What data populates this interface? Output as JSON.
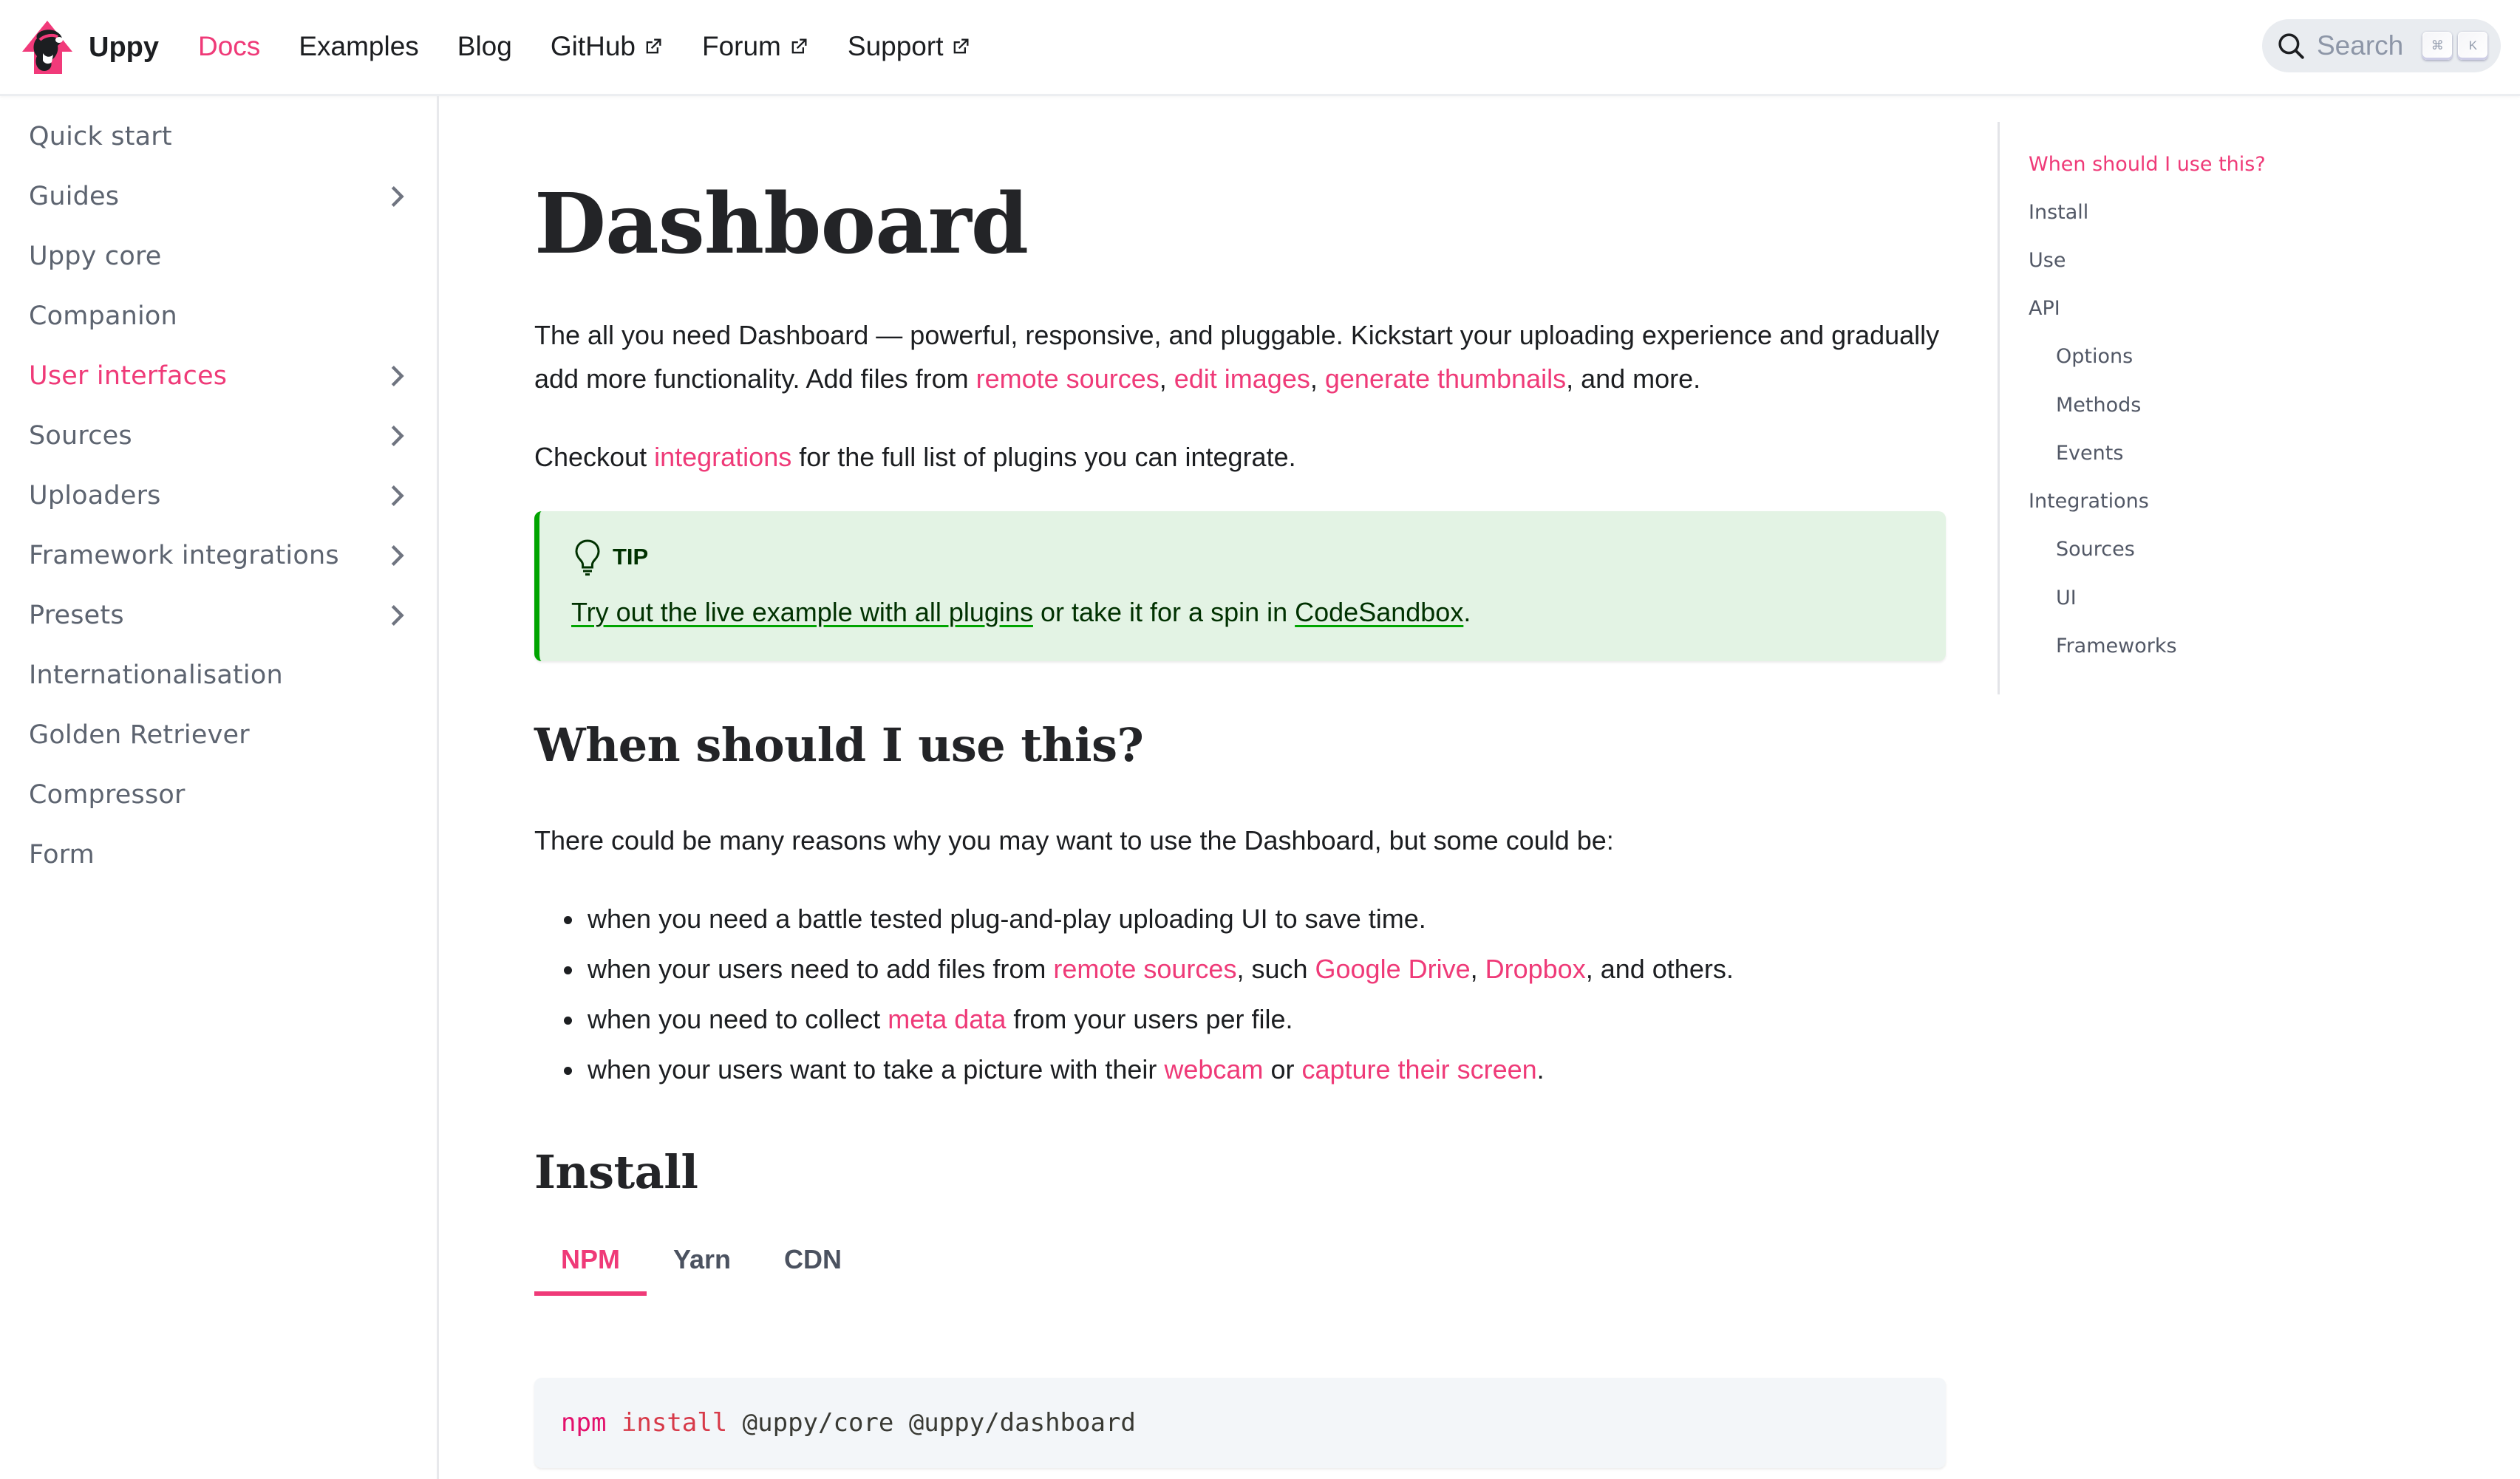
{
  "navbar": {
    "brand": "Uppy",
    "links": [
      {
        "label": "Docs",
        "active": true,
        "external": false
      },
      {
        "label": "Examples",
        "active": false,
        "external": false
      },
      {
        "label": "Blog",
        "active": false,
        "external": false
      },
      {
        "label": "GitHub",
        "active": false,
        "external": true
      },
      {
        "label": "Forum",
        "active": false,
        "external": true
      },
      {
        "label": "Support",
        "active": false,
        "external": true
      }
    ],
    "search": {
      "placeholder": "Search",
      "shortcut_keys": [
        "⌘",
        "K"
      ]
    }
  },
  "sidebar": {
    "items": [
      {
        "label": "Quick start",
        "expandable": false,
        "active": false
      },
      {
        "label": "Guides",
        "expandable": true,
        "active": false
      },
      {
        "label": "Uppy core",
        "expandable": false,
        "active": false
      },
      {
        "label": "Companion",
        "expandable": false,
        "active": false
      },
      {
        "label": "User interfaces",
        "expandable": true,
        "active": true
      },
      {
        "label": "Sources",
        "expandable": true,
        "active": false
      },
      {
        "label": "Uploaders",
        "expandable": true,
        "active": false
      },
      {
        "label": "Framework integrations",
        "expandable": true,
        "active": false
      },
      {
        "label": "Presets",
        "expandable": true,
        "active": false
      },
      {
        "label": "Internationalisation",
        "expandable": false,
        "active": false
      },
      {
        "label": "Golden Retriever",
        "expandable": false,
        "active": false
      },
      {
        "label": "Compressor",
        "expandable": false,
        "active": false
      },
      {
        "label": "Form",
        "expandable": false,
        "active": false
      }
    ]
  },
  "main": {
    "title": "Dashboard",
    "intro": {
      "t1": "The all you need Dashboard — powerful, responsive, and pluggable. Kickstart your uploading experience and gradually add more functionality. Add files from ",
      "link1": "remote sources",
      "t2": ", ",
      "link2": "edit images",
      "t3": ", ",
      "link3": "generate thumbnails",
      "t4": ", and more."
    },
    "checkout": {
      "t1": "Checkout ",
      "link": "integrations",
      "t2": " for the full list of plugins you can integrate."
    },
    "tip": {
      "label": "TIP",
      "link1": "Try out the live example with all plugins",
      "t1": " or take it for a spin in ",
      "link2": "CodeSandbox",
      "t2": "."
    },
    "when_heading": "When should I use this?",
    "when_intro": "There could be many reasons why you may want to use the Dashboard, but some could be:",
    "bullets": {
      "b1": {
        "t1": "when you need a battle tested plug-and-play uploading UI to save time."
      },
      "b2": {
        "t1": "when your users need to add files from ",
        "link1": "remote sources",
        "t2": ", such ",
        "link2": "Google Drive",
        "t3": ", ",
        "link3": "Dropbox",
        "t4": ", and others."
      },
      "b3": {
        "t1": "when you need to collect ",
        "link1": "meta data",
        "t2": " from your users per file."
      },
      "b4": {
        "t1": "when your users want to take a picture with their ",
        "link1": "webcam",
        "t2": " or ",
        "link2": "capture their screen",
        "t3": "."
      }
    },
    "install_heading": "Install",
    "install_tabs": [
      {
        "label": "NPM",
        "active": true
      },
      {
        "label": "Yarn",
        "active": false
      },
      {
        "label": "CDN",
        "active": false
      }
    ],
    "code": {
      "cmd": "npm",
      "sub": "install",
      "args": " @uppy/core @uppy/dashboard"
    }
  },
  "toc": {
    "items": [
      {
        "label": "When should I use this?",
        "level": 1,
        "active": true
      },
      {
        "label": "Install",
        "level": 1,
        "active": false
      },
      {
        "label": "Use",
        "level": 1,
        "active": false
      },
      {
        "label": "API",
        "level": 1,
        "active": false
      },
      {
        "label": "Options",
        "level": 2,
        "active": false
      },
      {
        "label": "Methods",
        "level": 2,
        "active": false
      },
      {
        "label": "Events",
        "level": 2,
        "active": false
      },
      {
        "label": "Integrations",
        "level": 1,
        "active": false
      },
      {
        "label": "Sources",
        "level": 2,
        "active": false
      },
      {
        "label": "UI",
        "level": 2,
        "active": false
      },
      {
        "label": "Frameworks",
        "level": 2,
        "active": false
      }
    ]
  },
  "colors": {
    "accent": "#ef3a78",
    "tip_background": "#e3f3e4",
    "tip_border": "#00a400",
    "code_background": "#f3f6f9"
  }
}
